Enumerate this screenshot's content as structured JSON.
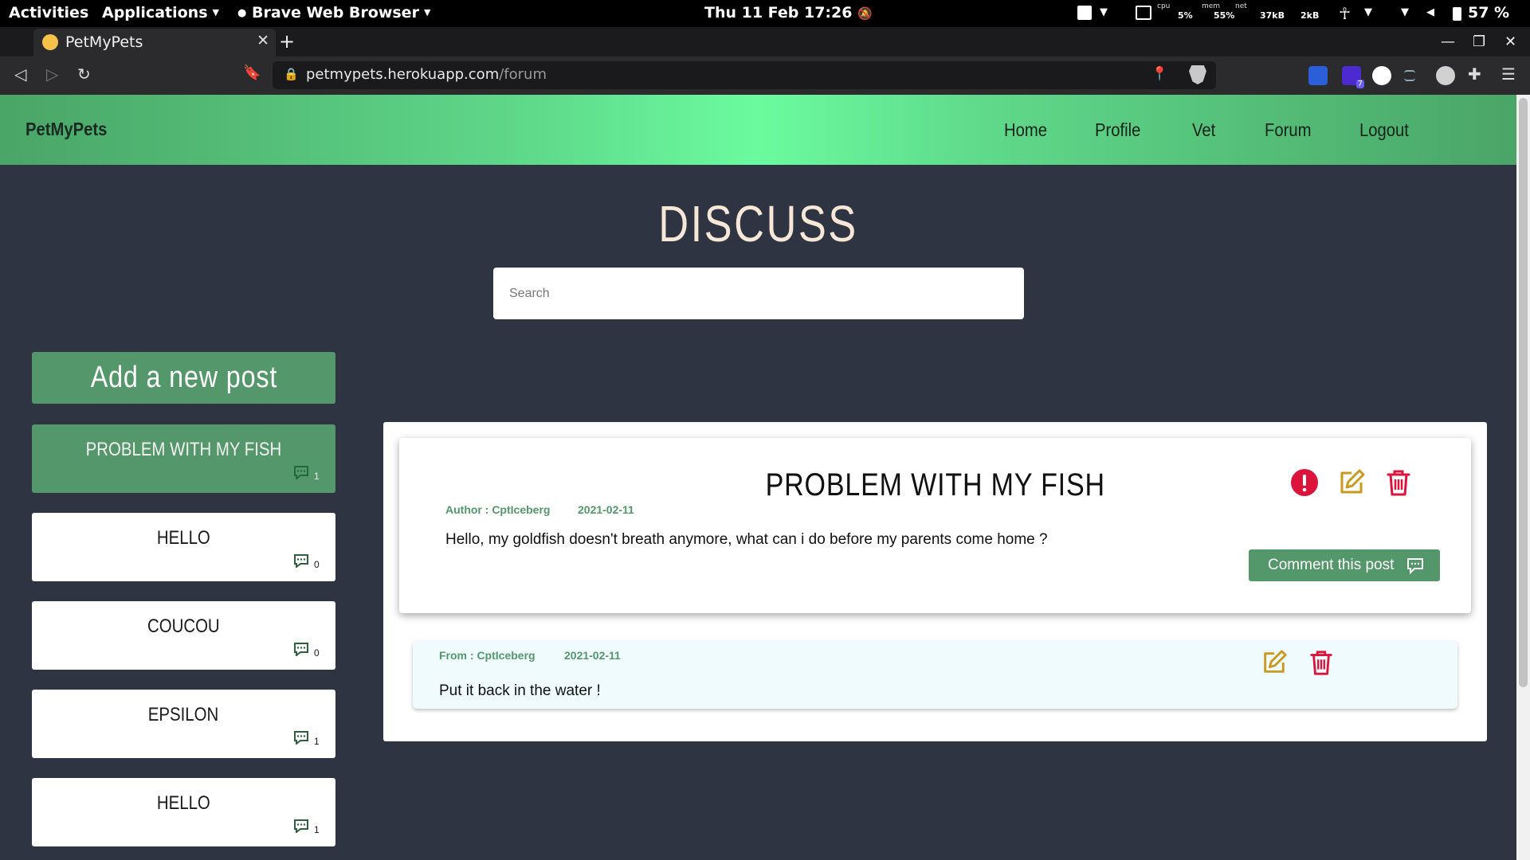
{
  "system_bar": {
    "activities": "Activities",
    "applications": "Applications",
    "app_name": "Brave Web Browser",
    "clock": "Thu 11 Feb  17:26",
    "cpu_label": "cpu",
    "cpu_value": "5%",
    "mem_label": "mem",
    "mem_value": "55%",
    "net_label": "net",
    "net_down": "37kB",
    "net_up": "2kB",
    "battery": "57 %"
  },
  "browser": {
    "tab_title": "PetMyPets",
    "url_host": "petmypets.herokuapp.com",
    "url_path": "/forum",
    "extension_badge": "7"
  },
  "navbar": {
    "brand": "PetMyPets",
    "links": [
      "Home",
      "Profile",
      "Vet",
      "Forum",
      "Logout"
    ]
  },
  "forum": {
    "heading": "DISCUSS",
    "search_placeholder": "Search",
    "add_post_label": "Add a new post",
    "posts": [
      {
        "title": "PROBLEM WITH MY FISH",
        "comments": "1",
        "active": true
      },
      {
        "title": "HELLO",
        "comments": "0",
        "active": false
      },
      {
        "title": "COUCOU",
        "comments": "0",
        "active": false
      },
      {
        "title": "EPSILON",
        "comments": "1",
        "active": false
      },
      {
        "title": "HELLO",
        "comments": "1",
        "active": false
      }
    ]
  },
  "selected_post": {
    "title": "PROBLEM WITH MY FISH",
    "author": "Author : CptIceberg",
    "date": "2021-02-11",
    "body": "Hello, my goldfish doesn't breath anymore, what can i do before my parents come home ?",
    "comment_button": "Comment this post"
  },
  "comment": {
    "from": "From : CptIceberg",
    "date": "2021-02-11",
    "text": "Put it back in the water !"
  },
  "colors": {
    "accent_green": "#54976a",
    "report_red": "#dc143c",
    "edit_gold": "#c99a1e",
    "page_bg": "#2f3443"
  }
}
